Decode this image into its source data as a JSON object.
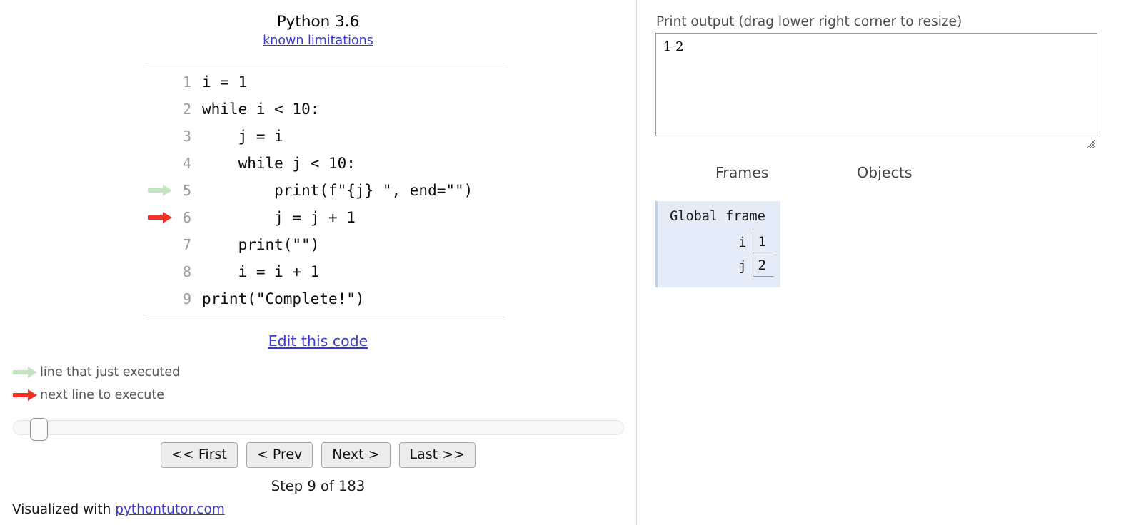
{
  "left": {
    "python_version": "Python 3.6",
    "known_limitations_link": "known limitations",
    "code_lines": [
      {
        "n": "1",
        "text": "i = 1",
        "marker": "none"
      },
      {
        "n": "2",
        "text": "while i < 10:",
        "marker": "none"
      },
      {
        "n": "3",
        "text": "    j = i",
        "marker": "none"
      },
      {
        "n": "4",
        "text": "    while j < 10:",
        "marker": "none"
      },
      {
        "n": "5",
        "text": "        print(f\"{j} \", end=\"\")",
        "marker": "green"
      },
      {
        "n": "6",
        "text": "        j = j + 1",
        "marker": "red"
      },
      {
        "n": "7",
        "text": "    print(\"\")",
        "marker": "none"
      },
      {
        "n": "8",
        "text": "    i = i + 1",
        "marker": "none"
      },
      {
        "n": "9",
        "text": "print(\"Complete!\")",
        "marker": "none"
      }
    ],
    "edit_link": "Edit this code",
    "legend": [
      {
        "label": "line that just executed",
        "color": "#c3e4c3"
      },
      {
        "label": "next line to execute",
        "color": "#ef3223"
      }
    ],
    "nav_buttons": [
      {
        "label": "<< First"
      },
      {
        "label": "< Prev"
      },
      {
        "label": "Next >"
      },
      {
        "label": "Last >>"
      }
    ],
    "step_label": "Step 9 of 183",
    "slider": {
      "value": 9,
      "min": 1,
      "max": 183
    },
    "footer_prefix": "Visualized with ",
    "footer_link": "pythontutor.com"
  },
  "right": {
    "print_output_label": "Print output (drag lower right corner to resize)",
    "print_output_text": "1 2 ",
    "columns": {
      "frames": "Frames",
      "objects": "Objects"
    },
    "frames": [
      {
        "title": "Global frame",
        "vars": [
          {
            "name": "i",
            "value": "1"
          },
          {
            "name": "j",
            "value": "2"
          }
        ]
      }
    ],
    "objects": []
  },
  "colors": {
    "executed_arrow": "#c3e4c3",
    "next_arrow": "#ef3223",
    "link": "#3a3ad0",
    "frame_bg": "#e3ecf7",
    "frame_border": "#bfcfe3"
  }
}
